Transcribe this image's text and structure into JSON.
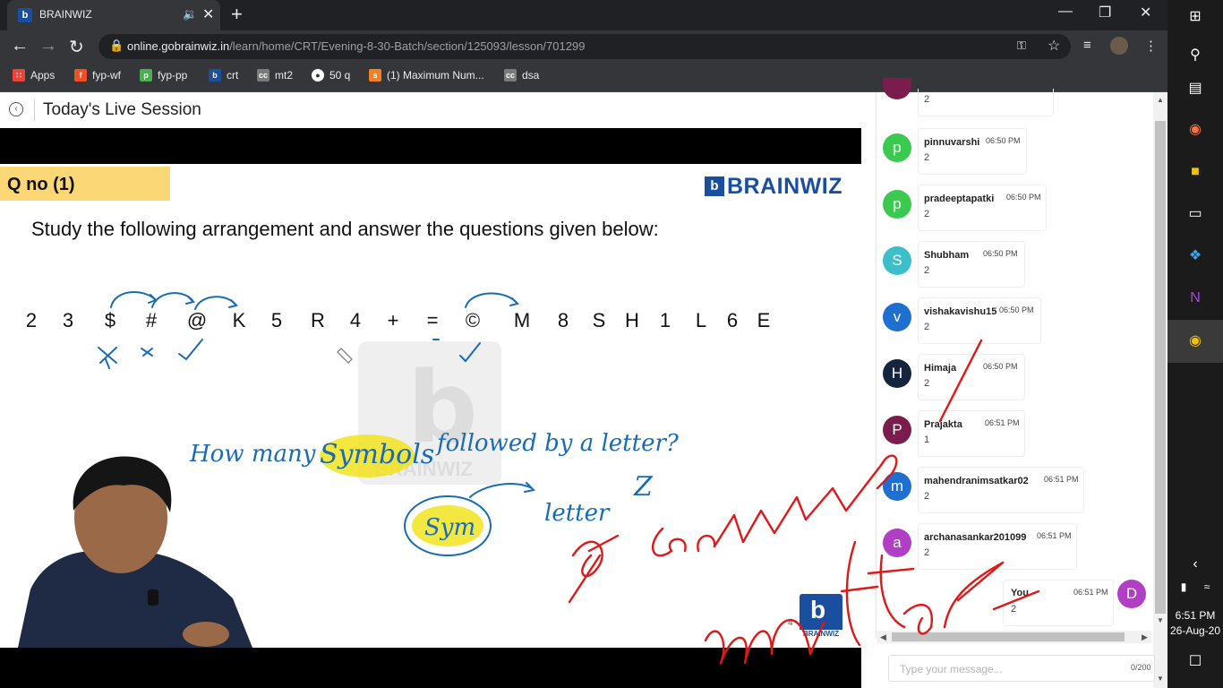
{
  "browser": {
    "tab_title": "BRAINWIZ",
    "url_host": "online.gobrainwiz.in",
    "url_path": "/learn/home/CRT/Evening-8-30-Batch/section/125093/lesson/701299",
    "bookmarks": [
      {
        "label": "Apps",
        "color": "#e8453c"
      },
      {
        "label": "fyp-wf",
        "color": "#f24e1e"
      },
      {
        "label": "fyp-pp",
        "color": "#4caf50"
      },
      {
        "label": "crt",
        "color": "#1a4fa0"
      },
      {
        "label": "mt2",
        "color": "#7a7a7a"
      },
      {
        "label": "50 q",
        "color": "#ffffff"
      },
      {
        "label": "(1) Maximum Num...",
        "color": "#f48024"
      },
      {
        "label": "dsa",
        "color": "#7a7a7a"
      }
    ]
  },
  "page": {
    "title": "Today's Live Session"
  },
  "slide": {
    "question_number": "Q no (1)",
    "brand": "BRAINWIZ",
    "question_text": "Study the following arrangement and answer the questions given below:",
    "sequence": [
      "2",
      "3",
      "$",
      "#",
      "@",
      "K",
      "5",
      "R",
      "4",
      "+",
      "=",
      "©",
      "M",
      "8",
      "S",
      "H",
      "1",
      "L",
      "6",
      "E"
    ],
    "handwriting": {
      "line1_a": "How many",
      "line1_highlight": "Symbols",
      "line1_b": "followed by a letter?",
      "sym": "Sym",
      "letter": "letter",
      "z": "Z"
    },
    "watermark_text": "BRAINWIZ",
    "slide_number": "4",
    "corner_logo_text": "BRAINWIZ"
  },
  "chat": {
    "messages": [
      {
        "name": "pinnuvarshi",
        "time": "06:50 PM",
        "text": "2",
        "initial": "p",
        "color": "#3cc94f"
      },
      {
        "name": "pradeeptapatki",
        "time": "06:50 PM",
        "text": "2",
        "initial": "p",
        "color": "#3cc94f"
      },
      {
        "name": "Shubham",
        "time": "06:50 PM",
        "text": "2",
        "initial": "S",
        "color": "#3cbfc8"
      },
      {
        "name": "vishakavishu15",
        "time": "06:50 PM",
        "text": "2",
        "initial": "v",
        "color": "#1f6fd1"
      },
      {
        "name": "Himaja",
        "time": "06:50 PM",
        "text": "2",
        "initial": "H",
        "color": "#14253d"
      },
      {
        "name": "Prajakta",
        "time": "06:51 PM",
        "text": "1",
        "initial": "P",
        "color": "#7a1d4c"
      },
      {
        "name": "mahendranimsatkar02",
        "time": "06:51 PM",
        "text": "2",
        "initial": "m",
        "color": "#1f6fd1"
      },
      {
        "name": "archanasankar201099",
        "time": "06:51 PM",
        "text": "2",
        "initial": "a",
        "color": "#b03fc6"
      }
    ],
    "mine": {
      "name": "You",
      "time": "06:51 PM",
      "text": "2",
      "initial": "D",
      "color": "#b03fc6"
    },
    "input_placeholder": "Type your message...",
    "char_count": "0/200"
  },
  "annotation": {
    "red_word_1": "accuracy",
    "red_word_2": "matter"
  },
  "taskbar": {
    "time": "6:51 PM",
    "date": "26-Aug-20"
  }
}
